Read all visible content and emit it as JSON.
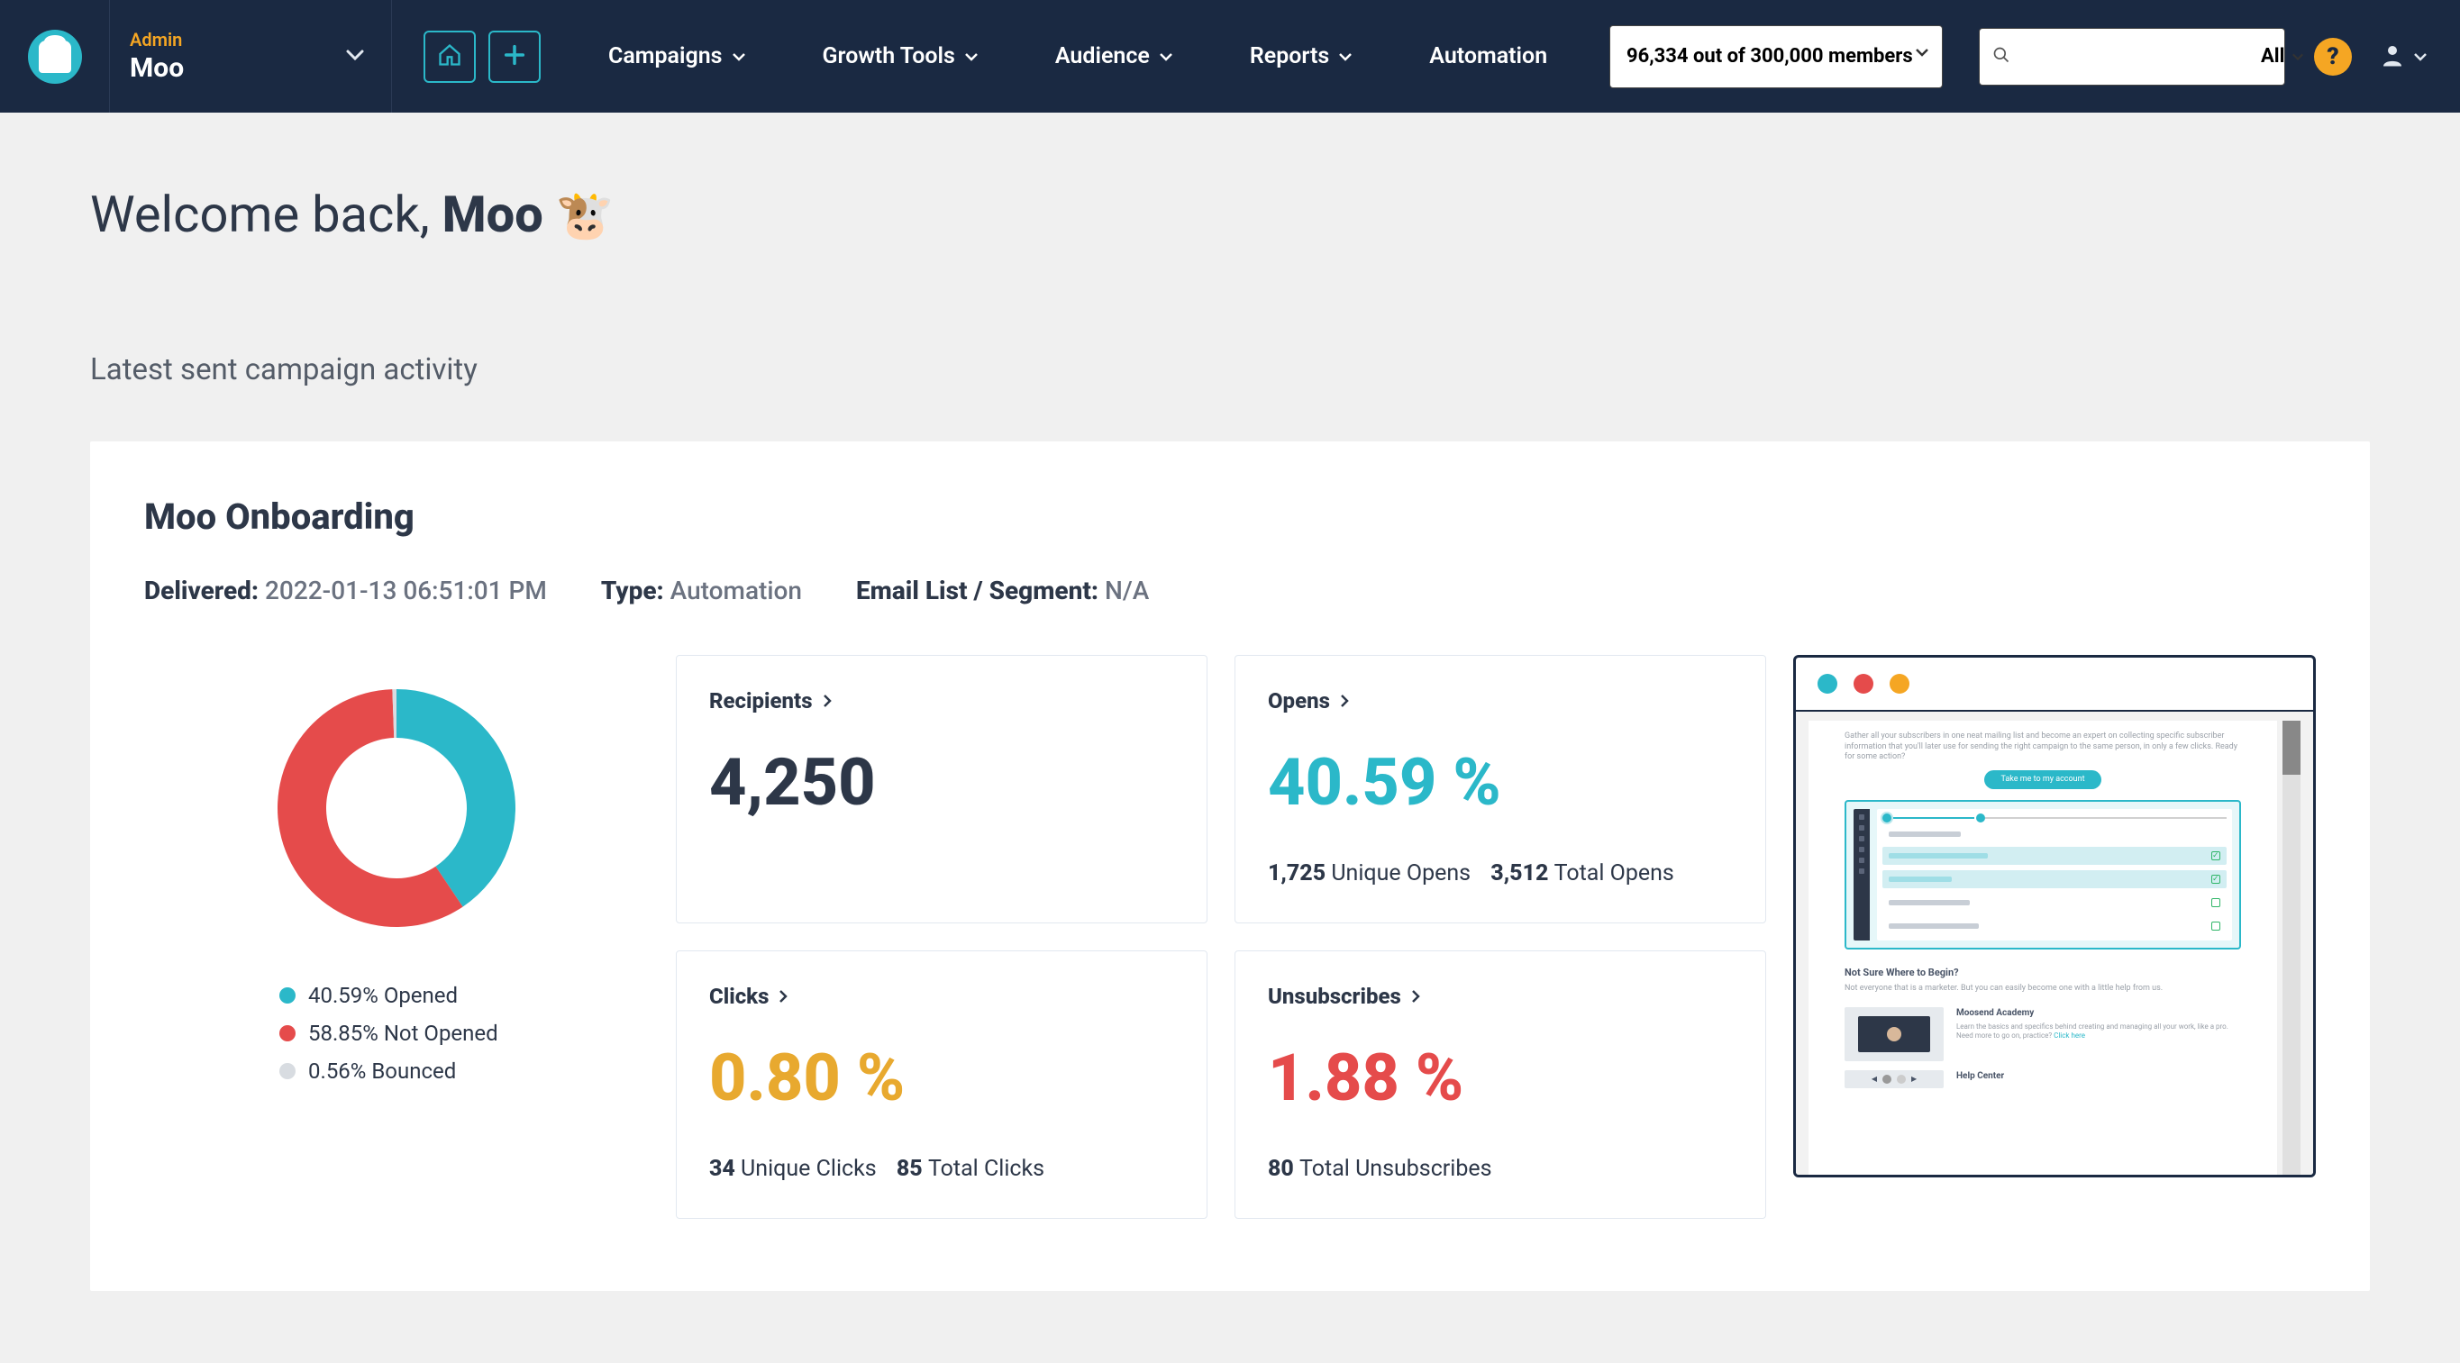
{
  "header": {
    "org_label": "Admin",
    "org_name": "Moo",
    "nav": {
      "campaigns": "Campaigns",
      "growth_tools": "Growth Tools",
      "audience": "Audience",
      "reports": "Reports",
      "automation": "Automation"
    },
    "members_display": "96,334 out of 300,000 members",
    "search_placeholder": "",
    "search_filter": "All"
  },
  "page": {
    "welcome_prefix": "Welcome back, ",
    "welcome_name": "Moo",
    "welcome_emoji": "🐮",
    "section_title": "Latest sent campaign activity"
  },
  "campaign": {
    "name": "Moo Onboarding",
    "delivered_label": "Delivered:",
    "delivered_value": "2022-01-13 06:51:01 PM",
    "type_label": "Type:",
    "type_value": "Automation",
    "list_label": "Email List / Segment:",
    "list_value": "N/A"
  },
  "chart_data": {
    "type": "pie",
    "title": "",
    "series": [
      {
        "name": "Opened",
        "value": 40.59,
        "color": "#2bb8c9",
        "label": "40.59% Opened"
      },
      {
        "name": "Not Opened",
        "value": 58.85,
        "color": "#e54b4b",
        "label": "58.85% Not Opened"
      },
      {
        "name": "Bounced",
        "value": 0.56,
        "color": "#d8dce1",
        "label": "0.56% Bounced"
      }
    ]
  },
  "metrics": {
    "recipients": {
      "title": "Recipients",
      "value": "4,250"
    },
    "opens": {
      "title": "Opens",
      "value": "40.59 %",
      "unique": "1,725",
      "unique_label": "Unique Opens",
      "total": "3,512",
      "total_label": "Total Opens"
    },
    "clicks": {
      "title": "Clicks",
      "value": "0.80 %",
      "unique": "34",
      "unique_label": "Unique Clicks",
      "total": "85",
      "total_label": "Total Clicks"
    },
    "unsubs": {
      "title": "Unsubscribes",
      "value": "1.88 %",
      "total": "80",
      "total_label": "Total Unsubscribes"
    }
  },
  "preview": {
    "cta": "Take me to my account",
    "section1_title": "Not Sure Where to Begin?",
    "section2_title": "Moosend Academy",
    "section3_title": "Help Center"
  }
}
